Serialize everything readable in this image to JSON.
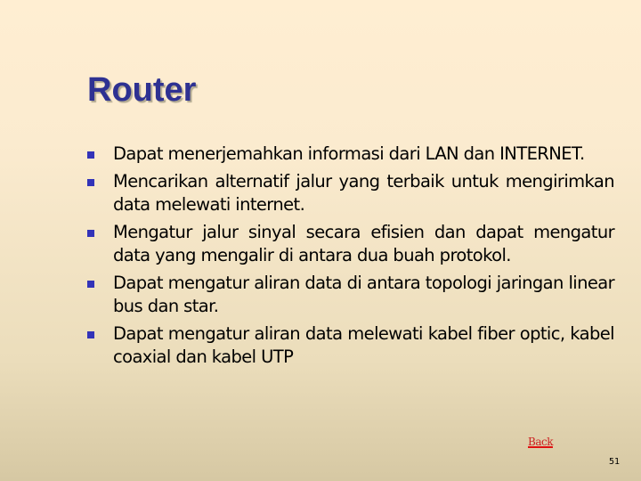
{
  "slide": {
    "title": "Router",
    "bullets": [
      "Dapat menerjemahkan informasi dari LAN dan INTERNET.",
      "Mencarikan alternatif jalur yang terbaik untuk mengirimkan data melewati internet.",
      "Mengatur jalur sinyal secara efisien dan dapat mengatur data yang mengalir di antara dua buah protokol.",
      "Dapat mengatur aliran data di antara topologi jaringan linear bus dan star.",
      "Dapat mengatur aliran data melewati kabel fiber optic, kabel coaxial dan kabel UTP"
    ],
    "bullet_icon": "square-bullet-icon",
    "back_link_label": "Back",
    "page_number": "51"
  },
  "colors": {
    "title": "#2E3192",
    "bullet": "#3333B8",
    "link": "#CC2222",
    "background_top": "#FFEED2",
    "background_bottom": "#D6C8A3"
  }
}
